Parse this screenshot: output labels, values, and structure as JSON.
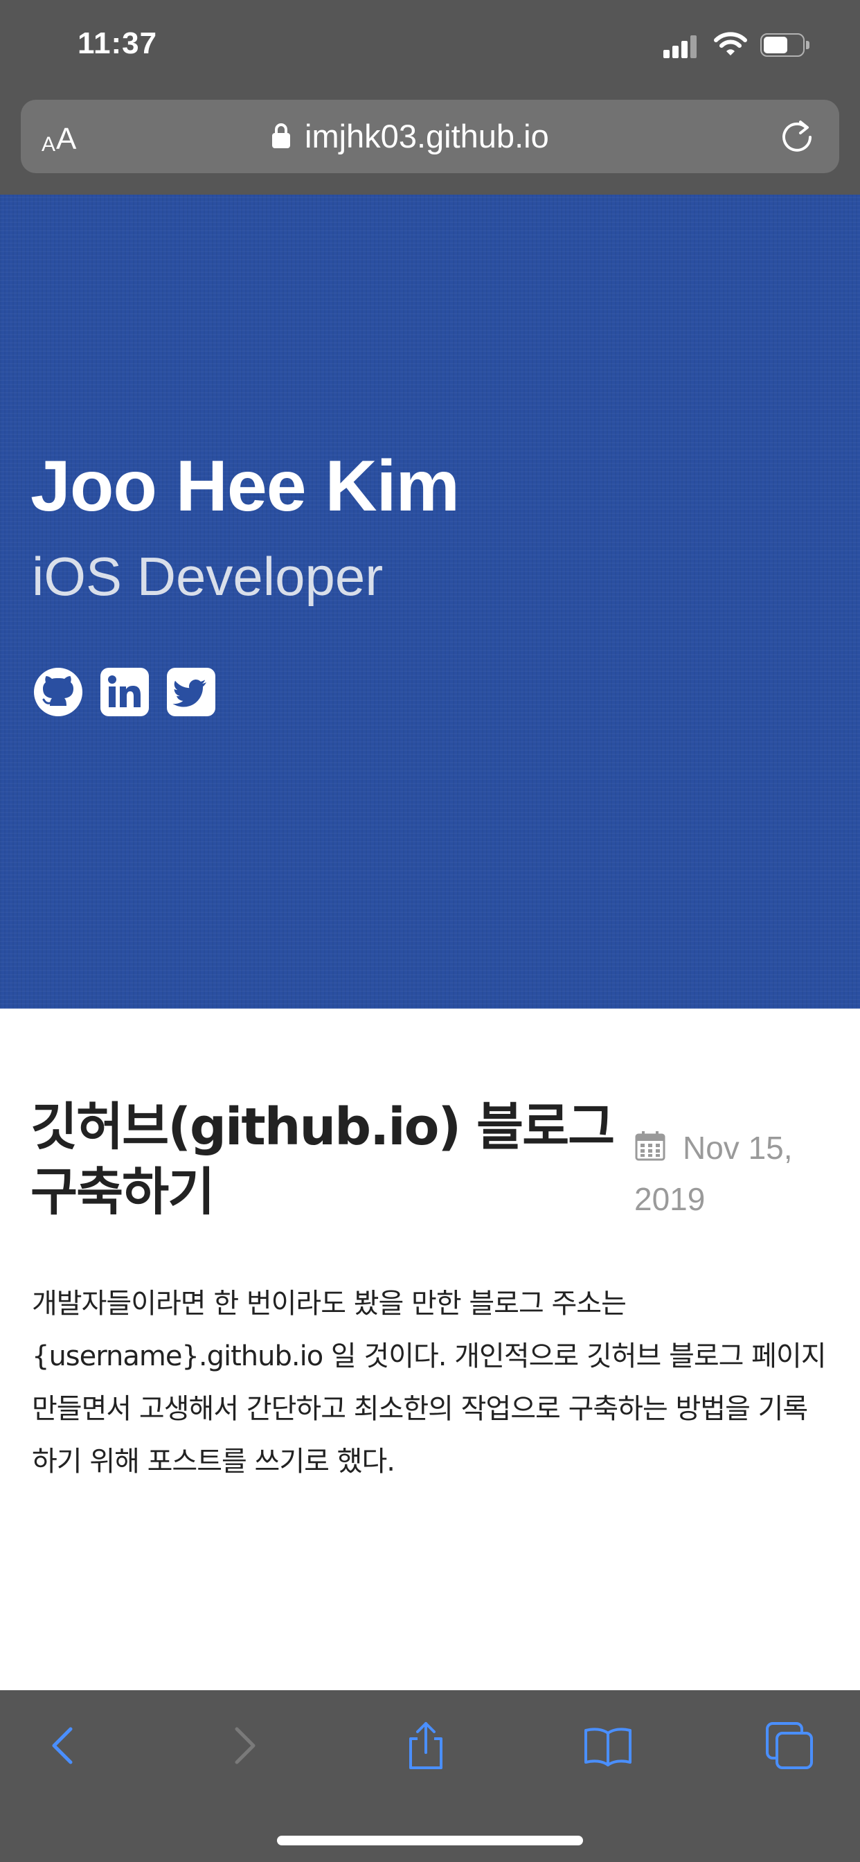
{
  "status_bar": {
    "time": "11:37"
  },
  "browser": {
    "text_size_small": "A",
    "text_size_large": "A",
    "url": "imjhk03.github.io"
  },
  "hero": {
    "name": "Joo Hee Kim",
    "role": "iOS Developer",
    "social_icons": [
      "github-icon",
      "linkedin-icon",
      "twitter-icon"
    ]
  },
  "post": {
    "title": "깃허브(github.io) 블로그 구축하기",
    "date": "Nov 15, 2019",
    "excerpt": "개발자들이라면 한 번이라도 봤을 만한 블로그 주소는 {username}.github.io 일 것이다. 개인적으로 깃허브 블로그 페이지 만들면서 고생해서 간단하고 최소한의 작업으로 구축하는 방법을 기록하기 위해 포스트를 쓰기로 했다."
  },
  "toolbar": {
    "icons": [
      "back-icon",
      "forward-icon",
      "share-icon",
      "bookmarks-icon",
      "tabs-icon"
    ]
  },
  "colors": {
    "hero_background": "#2a4fa1",
    "chrome_background": "#565656",
    "toolbar_active": "#4a8fff",
    "toolbar_disabled": "#7a7a7a"
  }
}
